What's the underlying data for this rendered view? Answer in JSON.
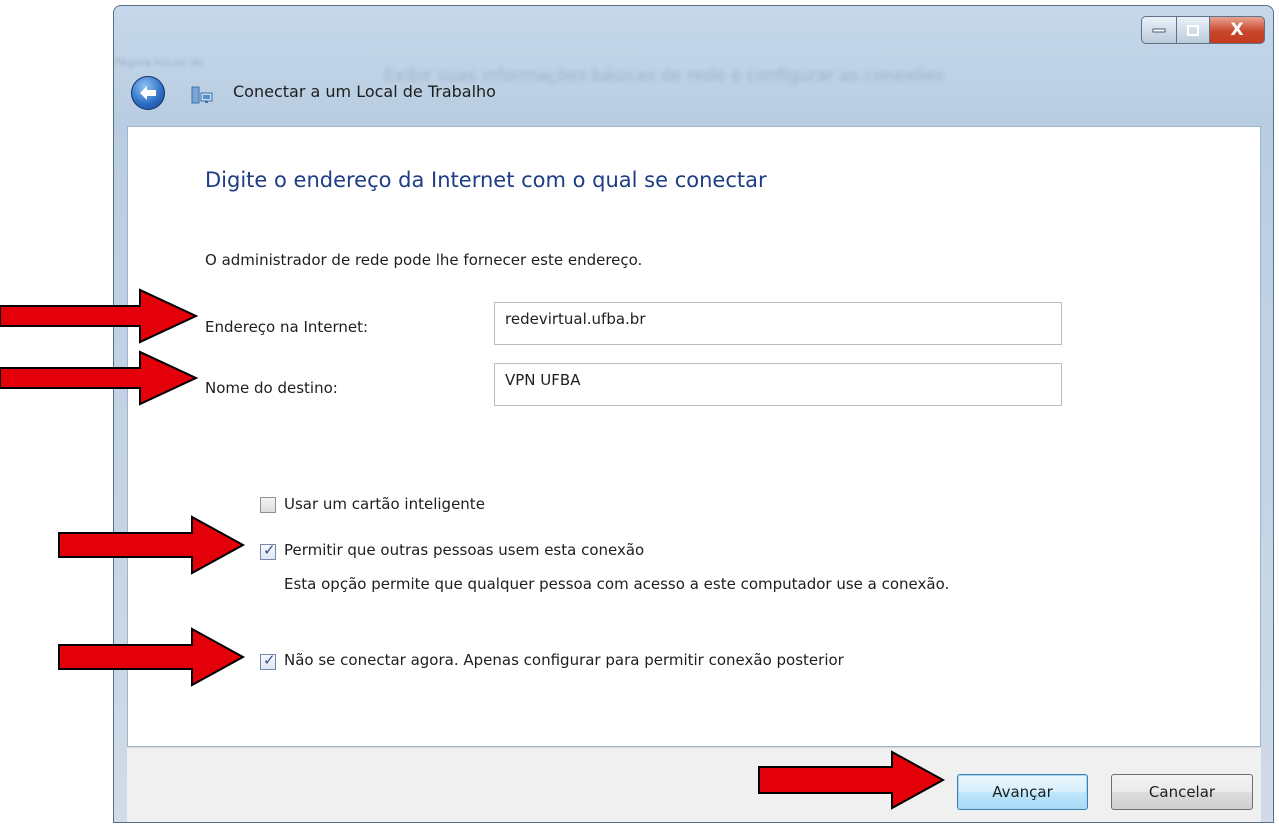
{
  "window": {
    "title": "Conectar a um Local de Trabalho",
    "background_text": "Exibir suas informações básicas de rede e configurar as conexões",
    "background_text_left": "Página Inicial do",
    "close_glyph": "X"
  },
  "page": {
    "heading": "Digite o endereço da Internet com o qual se conectar",
    "description": "O administrador de rede pode lhe fornecer este endereço."
  },
  "form": {
    "address_label": "Endereço na Internet:",
    "address_value": "redevirtual.ufba.br",
    "destination_label": "Nome do destino:",
    "destination_value": "VPN UFBA"
  },
  "options": {
    "smartcard": {
      "label": "Usar um cartão inteligente",
      "checked": false
    },
    "allow_others": {
      "label": "Permitir que outras pessoas usem esta conexão",
      "checked": true,
      "note": "Esta opção permite que qualquer pessoa com acesso a este computador use a conexão."
    },
    "dont_connect": {
      "label": "Não se conectar agora. Apenas configurar para permitir conexão posterior",
      "checked": true
    }
  },
  "buttons": {
    "next": "Avançar",
    "cancel": "Cancelar"
  },
  "colors": {
    "arrow": "#e3000b",
    "heading": "#1d3d84"
  }
}
